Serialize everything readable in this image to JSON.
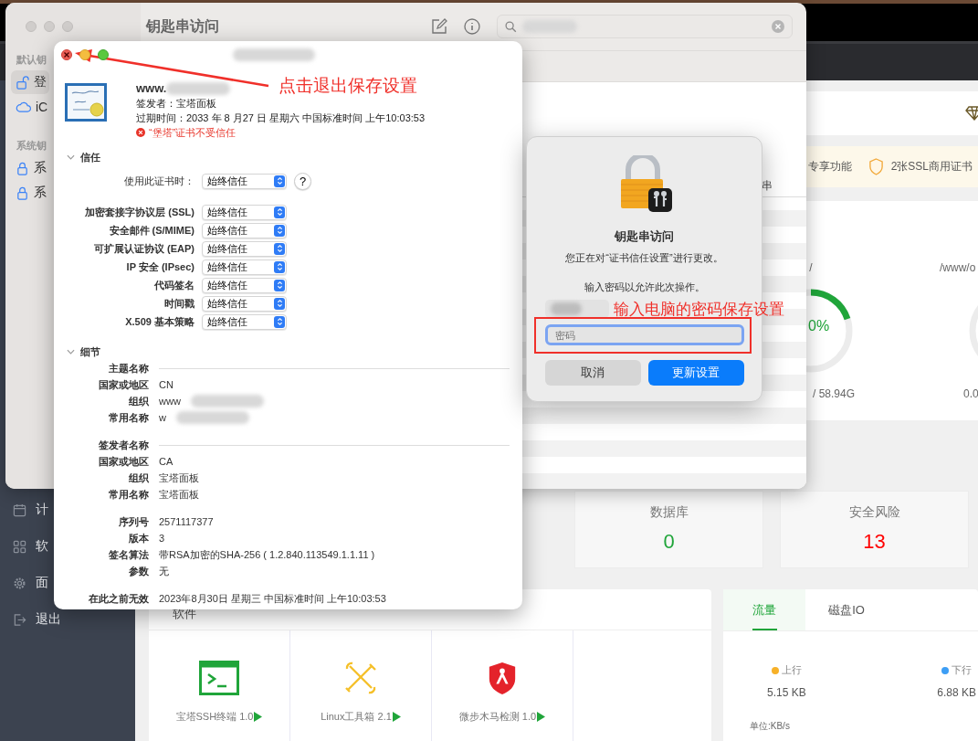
{
  "browser_page": {
    "sidebar": [
      {
        "label": "计",
        "kind": "calendar"
      },
      {
        "label": "软",
        "kind": "grid"
      },
      {
        "label": "面",
        "kind": "gear"
      },
      {
        "label": "退出",
        "kind": "logout"
      }
    ],
    "banner": [
      {
        "label": "专享功能",
        "kind": "text"
      },
      {
        "label": "2张SSL商用证书",
        "kind": "ssl"
      }
    ],
    "disks": [
      {
        "mount": "/",
        "level": 0.2,
        "percent": "0%",
        "usage": "/ 58.94G"
      },
      {
        "mount": "/www/o",
        "usage": "0.0"
      }
    ],
    "stats": [
      {
        "label": "数据库",
        "value": "0",
        "color": "#20a53a"
      },
      {
        "label": "安全风险",
        "value": "13",
        "color": "#ff0000"
      }
    ],
    "software": {
      "title": "软件",
      "items": [
        {
          "name": "宝塔SSH终端 1.0",
          "kind": "terminal"
        },
        {
          "name": "Linux工具箱 2.1",
          "kind": "tools"
        },
        {
          "name": "微步木马检测 1.0",
          "kind": "shield"
        }
      ]
    },
    "traffic": {
      "tabs": [
        {
          "label": "流量",
          "selected": true
        },
        {
          "label": "磁盘IO",
          "selected": false
        }
      ],
      "rates": [
        {
          "label": "上行",
          "color": "#f7b128",
          "value": "5.15 KB"
        },
        {
          "label": "下行",
          "color": "#3d9ef5",
          "value": "6.88 KB"
        }
      ],
      "unit": "单位:KB/s"
    }
  },
  "keychain_window": {
    "title": "钥匙串访问",
    "search": {
      "query_redacted": true
    },
    "sidebar": [
      {
        "title": "默认钥",
        "items": [
          {
            "label": "登",
            "kind": "lock-open",
            "selected": true
          },
          {
            "label": "iC",
            "kind": "cloud",
            "selected": false
          }
        ]
      },
      {
        "title": "系统钥",
        "items": [
          {
            "label": "系",
            "kind": "lock",
            "selected": false
          },
          {
            "label": "系",
            "kind": "lock",
            "selected": false
          }
        ]
      }
    ],
    "column_header": "串"
  },
  "certificate_window": {
    "title_redacted": true,
    "subject": "www.",
    "subject_redacted": true,
    "issuer": "签发者：宝塔面板",
    "expires": "过期时间：2033 年 8 月27 日 星期六 中国标准时间 上午10:03:53",
    "warning": "“堡塔”证书不受信任",
    "trust": {
      "title": "信任",
      "expanded": true,
      "when_using": {
        "label": "使用此证书时：",
        "value": "始终信任"
      },
      "help": "?",
      "rows": [
        {
          "label": "加密套接字协议层 (SSL)",
          "value": "始终信任"
        },
        {
          "label": "安全邮件 (S/MIME)",
          "value": "始终信任"
        },
        {
          "label": "可扩展认证协议 (EAP)",
          "value": "始终信任"
        },
        {
          "label": "IP 安全 (IPsec)",
          "value": "始终信任"
        },
        {
          "label": "代码签名",
          "value": "始终信任"
        },
        {
          "label": "时间戳",
          "value": "始终信任"
        },
        {
          "label": "X.509 基本策略",
          "value": "始终信任"
        }
      ]
    },
    "details": {
      "title": "细节",
      "expanded": true,
      "groups": [
        {
          "header": "主题名称",
          "rows": [
            {
              "label": "国家或地区",
              "value": "CN"
            },
            {
              "label": "组织",
              "value": "www",
              "redacted": true
            },
            {
              "label": "常用名称",
              "value": "w",
              "redacted": true
            }
          ]
        },
        {
          "header": "签发者名称",
          "rows": [
            {
              "label": "国家或地区",
              "value": "CA"
            },
            {
              "label": "组织",
              "value": "宝塔面板"
            },
            {
              "label": "常用名称",
              "value": "宝塔面板"
            }
          ]
        },
        {
          "rows": [
            {
              "label": "序列号",
              "value": "2571117377"
            },
            {
              "label": "版本",
              "value": "3"
            },
            {
              "label": "签名算法",
              "value": "带RSA加密的SHA-256 ( 1.2.840.113549.1.1.11 )"
            },
            {
              "label": "参数",
              "value": "无"
            }
          ]
        },
        {
          "rows": [
            {
              "label": "在此之前无效",
              "value": "2023年8月30日 星期三 中国标准时间 上午10:03:53"
            }
          ]
        }
      ]
    }
  },
  "password_dialog": {
    "title": "钥匙串访问",
    "message": "您正在对“证书信任设置”进行更改。",
    "prompt": "输入密码以允许此次操作。",
    "username_redacted": true,
    "password": {
      "placeholder": "密码",
      "focused": true
    },
    "buttons": [
      {
        "label": "取消",
        "kind": "cancel"
      },
      {
        "label": "更新设置",
        "kind": "default"
      }
    ]
  },
  "annotations": [
    {
      "kind": "arrow",
      "text": "点击退出保存设置"
    },
    {
      "kind": "box",
      "text": "输入电脑的密码保存设置"
    }
  ]
}
